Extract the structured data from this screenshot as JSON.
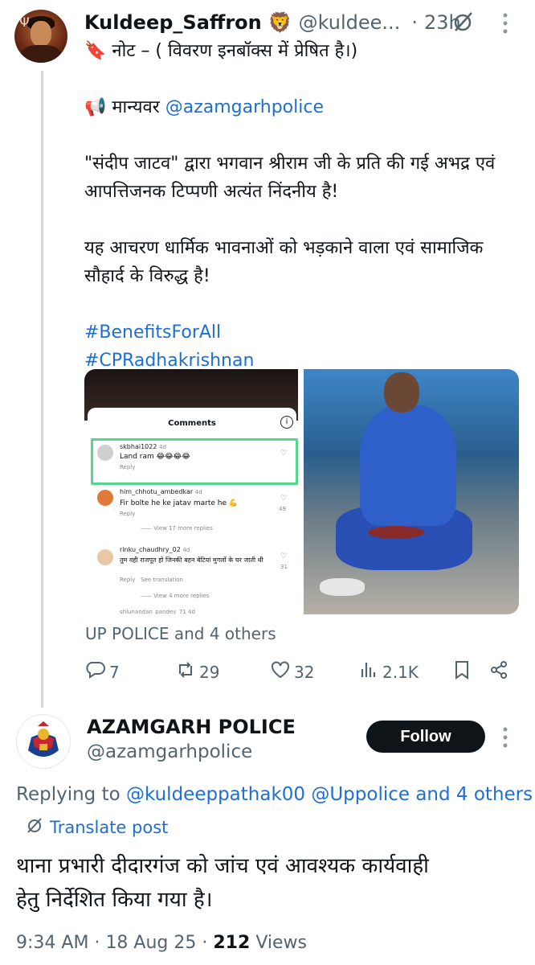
{
  "tweet": {
    "author_name": "Kuldeep_Saffron",
    "author_badge": "🦁",
    "handle": "@kuldee...",
    "separator": "·",
    "time": "23h",
    "note": "🔖 नोट – ( विवरण इनबॉक्स में प्रेषित है।)",
    "address_prefix": "📢 मान्यवर ",
    "address_mention": "@azamgarhpolice",
    "line1": "\"संदीप जाटव\" द्वारा भगवान श्रीराम जी के प्रति की गई अभद्र एवं आपत्तिजनक टिप्पणी अत्यंत निंदनीय है!",
    "line2": "यह आचरण धार्मिक भावनाओं को भड़काने वाला एवं सामाजिक सौहार्द के विरुद्ध है!",
    "hashtag1": "#BenefitsForAll",
    "hashtag2": "#CPRadhakrishnan",
    "liked_by": "UP POLICE and 4 others",
    "replies": "7",
    "reposts": "29",
    "likes": "32",
    "views": "2.1K"
  },
  "screenshot_comments": {
    "title": "Comments",
    "items": [
      {
        "user": "skbhai1022",
        "age": "4d",
        "text": "Land ram 😂😂😂😂",
        "reply": "Reply",
        "likes": ""
      },
      {
        "user": "him_chhotu_ambedkar",
        "age": "4d",
        "text": "Fir bolte he ke jatav marte he 💪",
        "reply": "Reply",
        "likes": "49"
      },
      {
        "user": "rinku_chaudhry_02",
        "age": "4d",
        "text": "तुम वही राजपूत हो जिनकी बहन बेटियां मुगलों के घर जाती थी",
        "reply": "Reply",
        "likes": "31",
        "extra": "See translation"
      },
      {
        "user": "shlunandan_pandey_71",
        "age": "4d"
      }
    ],
    "view_more_1": "View 17 more replies",
    "view_more_2": "View 4 more replies"
  },
  "reply": {
    "author_name": "AZAMGARH POLICE",
    "handle": "@azamgarhpolice",
    "follow_label": "Follow",
    "replying_prefix": "Replying to ",
    "replying_to": "@kuldeeppathak00 @Uppolice and 4 others",
    "translate_label": "Translate post",
    "text_line1": "थाना प्रभारी दीदारगंज को जांच एवं आवश्यक कार्यवाही",
    "text_line2": "हेतु निर्देशित किया गया है।",
    "time": "9:34 AM",
    "date": "18 Aug 25",
    "dot": "·",
    "views_count": "212",
    "views_label": "Views"
  },
  "colors": {
    "accent": "#1d6fd6",
    "muted": "#536471",
    "text": "#0f1419",
    "highlight": "#58d68d"
  },
  "icons": [
    "reply-icon",
    "repost-icon",
    "like-icon",
    "views-icon",
    "bookmark-icon",
    "share-icon",
    "grok-icon",
    "more-icon",
    "translate-icon"
  ]
}
